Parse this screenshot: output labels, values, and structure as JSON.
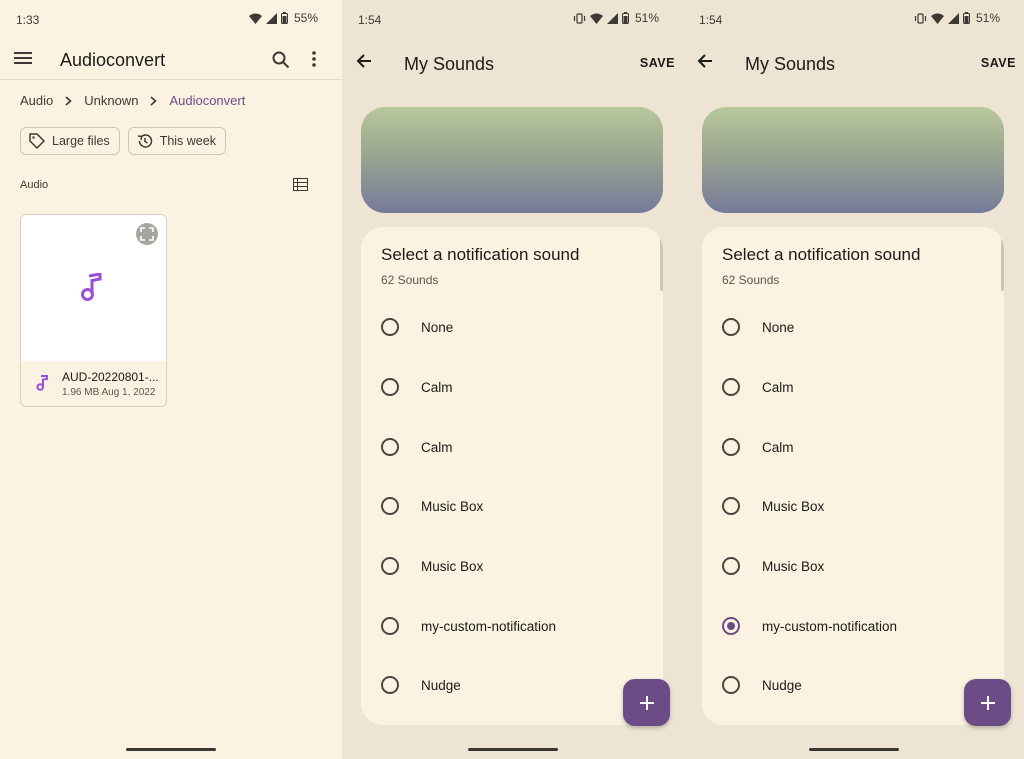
{
  "colors": {
    "accent": "#6b4c86",
    "background": "#fbf2e2",
    "music_icon": "#9b4ed8"
  },
  "screen1": {
    "status": {
      "time": "1:33",
      "battery": "55%"
    },
    "appbar": {
      "title": "Audioconvert"
    },
    "breadcrumb": [
      "Audio",
      "Unknown",
      "Audioconvert"
    ],
    "chips": [
      "Large files",
      "This week"
    ],
    "section_label": "Audio",
    "file": {
      "name": "AUD-20220801-...",
      "size_date": "1.96 MB  Aug 1, 2022"
    }
  },
  "screen2": {
    "status": {
      "time": "1:54",
      "battery": "51%"
    },
    "appbar": {
      "title": "My Sounds",
      "save_label": "SAVE"
    },
    "sheet": {
      "title": "Select a notification sound",
      "count": "62 Sounds"
    },
    "options": [
      "None",
      "Calm",
      "Calm",
      "Music Box",
      "Music Box",
      "my-custom-notification",
      "Nudge"
    ],
    "selected_index": -1
  },
  "screen3": {
    "status": {
      "time": "1:54",
      "battery": "51%"
    },
    "appbar": {
      "title": "My Sounds",
      "save_label": "SAVE"
    },
    "sheet": {
      "title": "Select a notification sound",
      "count": "62 Sounds"
    },
    "options": [
      "None",
      "Calm",
      "Calm",
      "Music Box",
      "Music Box",
      "my-custom-notification",
      "Nudge"
    ],
    "selected_index": 5
  }
}
